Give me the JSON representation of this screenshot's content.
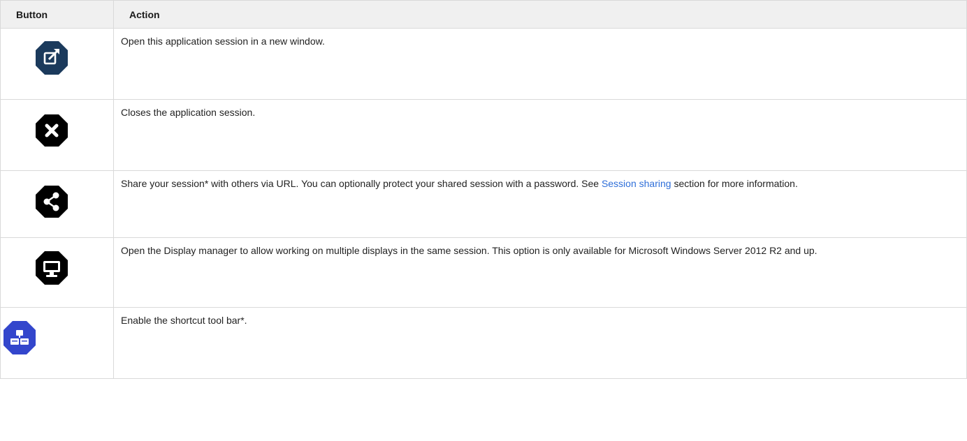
{
  "table": {
    "headers": {
      "button": "Button",
      "action": "Action"
    },
    "rows": [
      {
        "icon": "open-in-new-window-icon",
        "color": "#1b3a5c",
        "text": "Open this application session in a new window."
      },
      {
        "icon": "close-icon",
        "color": "#000000",
        "text": "Closes the application session."
      },
      {
        "icon": "share-icon",
        "color": "#000000",
        "text_before": "Share your session* with others via URL. You can optionally protect your shared session with a password. See ",
        "link_text": "Session sharing",
        "text_after": " section for more information."
      },
      {
        "icon": "monitor-icon",
        "color": "#000000",
        "text": "Open the Display manager to allow working on multiple displays in the same session. This option is only available for Microsoft Windows Server 2012 R2 and up."
      },
      {
        "icon": "shortcut-toolbar-icon",
        "color": "#3346cc",
        "text": "Enable the shortcut tool bar*."
      }
    ]
  },
  "colors": {
    "link": "#2f6fd9",
    "header_bg": "#f0f0f0",
    "border": "#d9d9d9"
  }
}
